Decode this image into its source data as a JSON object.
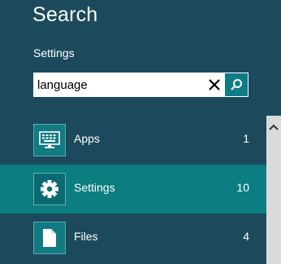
{
  "header": {
    "title": "Search",
    "scope": "Settings"
  },
  "search": {
    "value": "language",
    "clear_icon": "close-icon",
    "submit_icon": "search-icon"
  },
  "results": [
    {
      "label": "Apps",
      "count": "1",
      "icon": "keyboard-icon",
      "selected": false
    },
    {
      "label": "Settings",
      "count": "10",
      "icon": "gear-icon",
      "selected": true
    },
    {
      "label": "Files",
      "count": "4",
      "icon": "document-icon",
      "selected": false
    }
  ],
  "colors": {
    "background": "#1c4a5c",
    "selected_row": "#0c7d81",
    "accent": "#0e7c87"
  }
}
